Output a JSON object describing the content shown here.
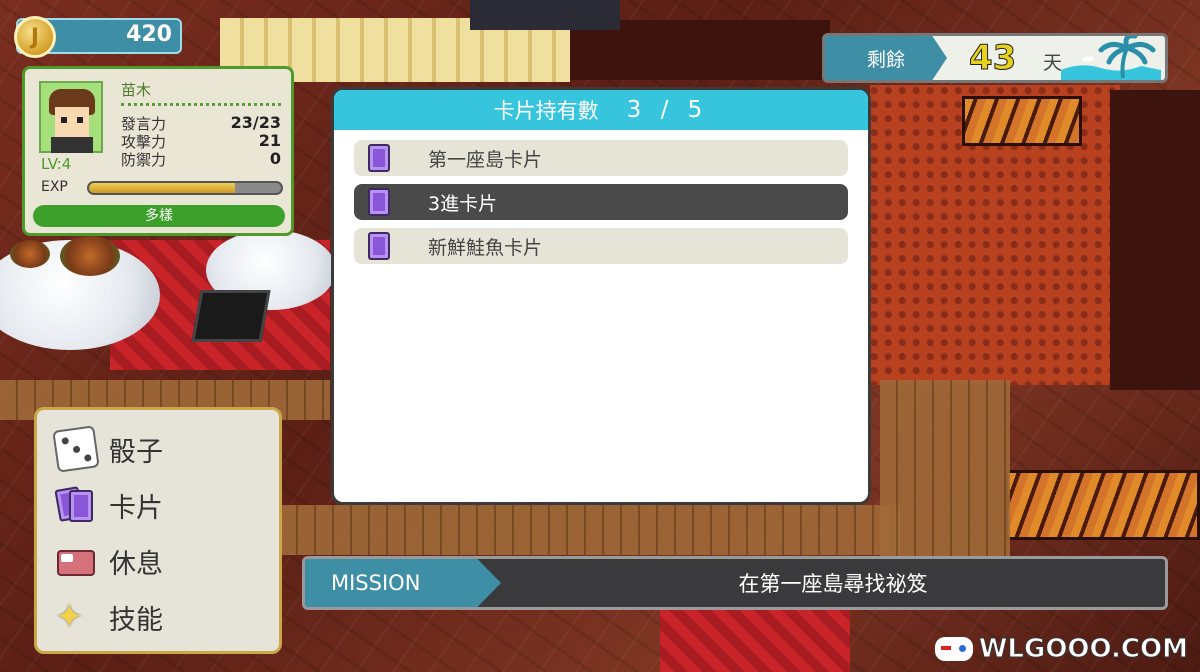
{
  "coins": {
    "value": "420",
    "icon": "coin-icon",
    "symbol": "J"
  },
  "character": {
    "name": "苗木",
    "stats": [
      {
        "label": "發言力",
        "value": "23/23"
      },
      {
        "label": "攻擊力",
        "value": "21"
      },
      {
        "label": "防禦力",
        "value": "0"
      }
    ],
    "level": "LV:4",
    "exp_label": "EXP",
    "exp_progress": 0.76,
    "status": "多樣"
  },
  "days": {
    "label": "剩餘",
    "value": "43",
    "unit": "天"
  },
  "dialog": {
    "title": "卡片持有數",
    "count": "3 / 5",
    "cards": [
      {
        "name": "第一座島卡片",
        "selected": false
      },
      {
        "name": "3進卡片",
        "selected": true
      },
      {
        "name": "新鮮鮭魚卡片",
        "selected": false
      }
    ]
  },
  "menu": {
    "items": [
      {
        "label": "骰子",
        "icon": "dice-icon"
      },
      {
        "label": "卡片",
        "icon": "cards-icon"
      },
      {
        "label": "休息",
        "icon": "bed-icon"
      },
      {
        "label": "技能",
        "icon": "sparkle-icon"
      }
    ]
  },
  "mission": {
    "label": "MISSION",
    "text": "在第一座島尋找祕笈"
  },
  "watermark": "WLGOOO.COM",
  "colors": {
    "accent": "#36c5dc",
    "tag": "#3e8fa5",
    "frame_green": "#4e9a2a",
    "menu_gold": "#caa84a"
  }
}
